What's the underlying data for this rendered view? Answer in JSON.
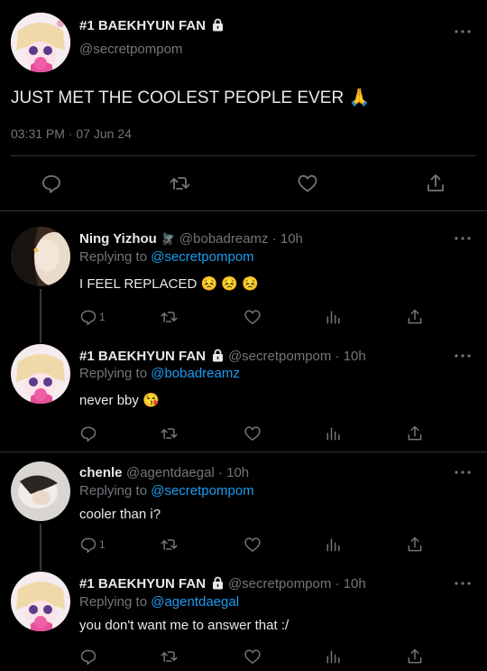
{
  "main": {
    "author_name": "#1 BAEKHYUN FAN",
    "author_handle": "@secretpompom",
    "text": "JUST MET THE COOLEST PEOPLE EVER 🙏",
    "timestamp": "03:31 PM · 07 Jun 24"
  },
  "replies": [
    {
      "name": "Ning Yizhou",
      "badge": "🪰",
      "handle": "@bobadreamz · 10h",
      "replying_label": "Replying to",
      "replying_to": "@secretpompom",
      "text": "I FEEL REPLACED 😣 😣 😣",
      "reply_count": "1"
    },
    {
      "name": "#1 BAEKHYUN FAN",
      "handle": "@secretpompom · 10h",
      "replying_label": "Replying to",
      "replying_to": "@bobadreamz",
      "text": "never bby 😘",
      "reply_count": ""
    },
    {
      "name": "chenle",
      "handle": "@agentdaegal · 10h",
      "replying_label": "Replying to",
      "replying_to": "@secretpompom",
      "text": "cooler than i?",
      "reply_count": "1"
    },
    {
      "name": "#1 BAEKHYUN FAN",
      "handle": "@secretpompom · 10h",
      "replying_label": "Replying to",
      "replying_to": "@agentdaegal",
      "text": "you don't want me to answer that :/",
      "reply_count": ""
    }
  ],
  "colors": {
    "background": "#000000",
    "text": "#e7e9ea",
    "muted": "#71767b",
    "link": "#1d9bf0",
    "divider": "#2f3336"
  },
  "icons": [
    "more-icon",
    "lock-icon",
    "reply-icon",
    "retweet-icon",
    "like-icon",
    "views-icon",
    "share-icon"
  ]
}
